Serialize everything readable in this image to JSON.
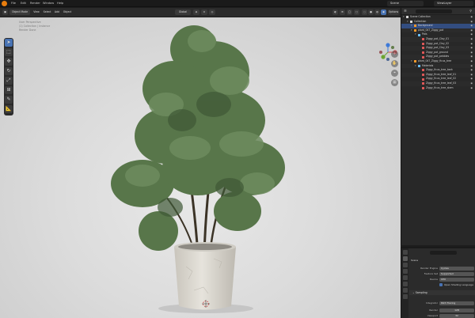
{
  "topbar": {
    "menus": [
      "File",
      "Edit",
      "Render",
      "Window",
      "Help"
    ],
    "scene": "Scene",
    "view_layer": "ViewLayer"
  },
  "viewport_header": {
    "mode": "Object Mode",
    "view": "View",
    "select": "Select",
    "add": "Add",
    "object": "Object",
    "transform_orientation": "Global",
    "options": "Options"
  },
  "viewport_info": {
    "line1": "User Perspective",
    "line2": "(1) Collection | Instance",
    "line3": "Render Done"
  },
  "toolbar": {
    "tools": [
      "cursor-select",
      "select-box",
      "move",
      "rotate",
      "scale",
      "transform",
      "annotate",
      "measure"
    ]
  },
  "gizmo": {
    "x_color": "#e0484c",
    "y_color": "#6ba52f",
    "z_color": "#3e7ad8"
  },
  "outliner": {
    "title": "Scene Collection",
    "rows": [
      {
        "label": "Scene Collection",
        "indent": 0,
        "icon_color": "#dddddd",
        "selected": false
      },
      {
        "label": "Collection",
        "indent": 1,
        "icon_color": "#dddddd",
        "selected": false
      },
      {
        "label": "Background",
        "indent": 2,
        "icon_color": "#ff9b29",
        "selected": true
      },
      {
        "label": "plant_047_Ziggy_pot",
        "indent": 2,
        "icon_color": "#ff9b29",
        "selected": false
      },
      {
        "label": "Pots",
        "indent": 3,
        "icon_color": "#6cc1ff",
        "selected": false
      },
      {
        "label": "Ziggy_pot_Clay_01",
        "indent": 4,
        "icon_color": "#e05858",
        "selected": false
      },
      {
        "label": "Ziggy_pot_Clay_02",
        "indent": 4,
        "icon_color": "#e05858",
        "selected": false
      },
      {
        "label": "Ziggy_pot_Clay_03",
        "indent": 4,
        "icon_color": "#e05858",
        "selected": false
      },
      {
        "label": "Ziggy_pot_ground",
        "indent": 4,
        "icon_color": "#e05858",
        "selected": false
      },
      {
        "label": "Ziggy_pot_pebbles",
        "indent": 4,
        "icon_color": "#e05858",
        "selected": false
      },
      {
        "label": "plant_047_Ziggy_ficus_tree",
        "indent": 2,
        "icon_color": "#ff9b29",
        "selected": false
      },
      {
        "label": "Materials",
        "indent": 3,
        "icon_color": "#6cc1ff",
        "selected": false
      },
      {
        "label": "Ziggy_ficus_tree_bark",
        "indent": 4,
        "icon_color": "#e05858",
        "selected": false
      },
      {
        "label": "Ziggy_ficus_tree_leaf_01",
        "indent": 4,
        "icon_color": "#e05858",
        "selected": false
      },
      {
        "label": "Ziggy_ficus_tree_leaf_02",
        "indent": 4,
        "icon_color": "#e05858",
        "selected": false
      },
      {
        "label": "Ziggy_ficus_tree_leaf_03",
        "indent": 4,
        "icon_color": "#e05858",
        "selected": false
      },
      {
        "label": "Ziggy_ficus_tree_stem",
        "indent": 4,
        "icon_color": "#e05858",
        "selected": false
      }
    ]
  },
  "properties": {
    "context": "Scene",
    "render_engine_label": "Render Engine",
    "render_engine_value": "Cycles",
    "feature_set_label": "Feature Set",
    "feature_set_value": "Supported",
    "device_label": "Device",
    "device_value": "CPU",
    "osl_label": "Open Shading Language",
    "sampling_label": "Sampling",
    "integrator_label": "Integrator",
    "integrator_value": "Path Tracing",
    "render_label": "Render",
    "render_value": "128",
    "viewport_label": "Viewport",
    "viewport_value": "32"
  },
  "colors": {
    "accent": "#4772b3",
    "selection": "#334d80",
    "leaf": "#5b7a4c",
    "pot": "#d9d6cf"
  }
}
